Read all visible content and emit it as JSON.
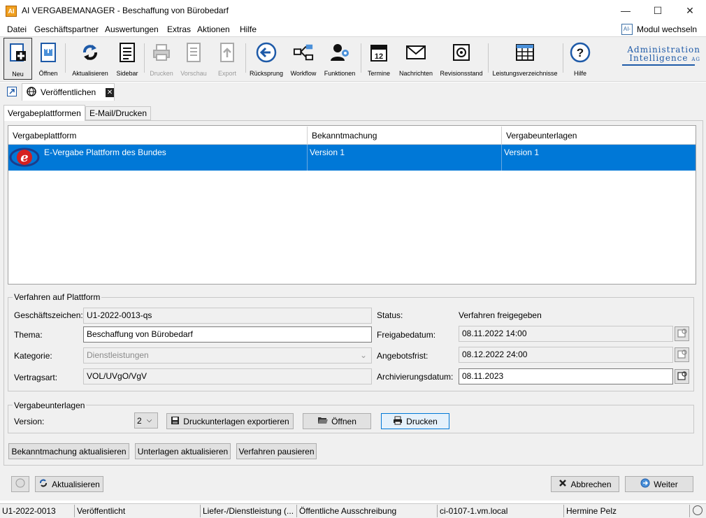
{
  "window": {
    "app_icon_text": "AI",
    "title": "AI VERGABEMANAGER - Beschaffung von Bürobedarf",
    "minimize": "—",
    "maximize": "☐",
    "close": "✕"
  },
  "menu": {
    "items": [
      "Datei",
      "Geschäftspartner",
      "Auswertungen",
      "Extras",
      "Aktionen",
      "Hilfe"
    ],
    "modul_icon": "AI-",
    "modul_wechseln": "Modul wechseln"
  },
  "toolbar": {
    "buttons": [
      {
        "label": "Neu",
        "icon": "new-document-icon",
        "enabled": true
      },
      {
        "label": "Öffnen",
        "icon": "open-document-icon",
        "enabled": true
      },
      {
        "label": "Aktualisieren",
        "icon": "refresh-icon",
        "enabled": true
      },
      {
        "label": "Sidebar",
        "icon": "sidebar-icon",
        "enabled": true
      },
      {
        "label": "Drucken",
        "icon": "printer-icon",
        "enabled": false
      },
      {
        "label": "Vorschau",
        "icon": "preview-icon",
        "enabled": false
      },
      {
        "label": "Export",
        "icon": "export-icon",
        "enabled": false
      },
      {
        "label": "Rücksprung",
        "icon": "back-arrow-icon",
        "enabled": true
      },
      {
        "label": "Workflow",
        "icon": "workflow-icon",
        "enabled": true
      },
      {
        "label": "Funktionen",
        "icon": "functions-icon",
        "enabled": true
      },
      {
        "label": "Termine",
        "icon": "calendar-icon",
        "enabled": true
      },
      {
        "label": "Nachrichten",
        "icon": "envelope-icon",
        "enabled": true
      },
      {
        "label": "Revisionsstand",
        "icon": "safe-icon",
        "enabled": true
      },
      {
        "label": "Leistungsverzeichnisse",
        "icon": "table-grid-icon",
        "enabled": true
      },
      {
        "label": "Hilfe",
        "icon": "help-icon",
        "enabled": true
      }
    ],
    "logo_line1": "Administration",
    "logo_line2": "Intelligence",
    "logo_suffix": "AG",
    "calendar_day": "12"
  },
  "doc_tab": {
    "label": "Veröffentlichen",
    "close": "✕"
  },
  "subtabs": [
    "Vergabeplattformen",
    "E-Mail/Drucken"
  ],
  "table": {
    "headers": [
      "Vergabeplattform",
      "Bekanntmachung",
      "Vergabeunterlagen"
    ],
    "rows": [
      {
        "platform": "E-Vergabe Plattform des Bundes",
        "bekanntmachung": "Version 1",
        "unterlagen": "Version 1",
        "logo_letter": "e"
      }
    ]
  },
  "verfahren": {
    "title": "Verfahren auf Plattform",
    "geschaeftszeichen_label": "Geschäftszeichen:",
    "geschaeftszeichen_value": "U1-2022-0013-qs",
    "thema_label": "Thema:",
    "thema_value": "Beschaffung von Bürobedarf",
    "kategorie_label": "Kategorie:",
    "kategorie_value": "Dienstleistungen",
    "vertragsart_label": "Vertragsart:",
    "vertragsart_value": "VOL/UVgO/VgV",
    "status_label": "Status:",
    "status_value": "Verfahren freigegeben",
    "freigabedatum_label": "Freigabedatum:",
    "freigabedatum_value": "08.11.2022 14:00",
    "angebotsfrist_label": "Angebotsfrist:",
    "angebotsfrist_value": "08.12.2022 24:00",
    "archivierungsdatum_label": "Archivierungsdatum:",
    "archivierungsdatum_value": "08.11.2023"
  },
  "unterlagen": {
    "title": "Vergabeunterlagen",
    "version_label": "Version:",
    "version_value": "2",
    "export_button": "Druckunterlagen exportieren",
    "open_button": "Öffnen",
    "print_button": "Drucken"
  },
  "actions": {
    "bekanntmachung": "Bekanntmachung aktualisieren",
    "unterlagen": "Unterlagen aktualisieren",
    "pausieren": "Verfahren pausieren"
  },
  "footer": {
    "aktualisieren": "Aktualisieren",
    "abbrechen": "Abbrechen",
    "weiter": "Weiter"
  },
  "statusbar": {
    "cells": [
      "U1-2022-0013",
      "Veröffentlicht",
      "Liefer-/Dienstleistung (...",
      "Öffentliche Ausschreibung",
      "ci-0107-1.vm.local",
      "Hermine Pelz"
    ]
  },
  "colors": {
    "selection": "#0078d7",
    "panel": "#f0f0f0",
    "accent": "#1e5aa8"
  }
}
